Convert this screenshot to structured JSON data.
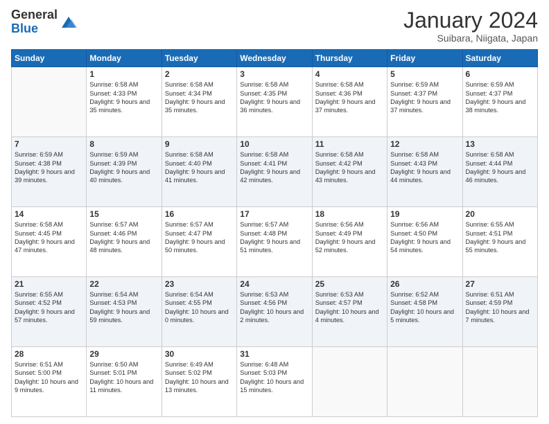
{
  "logo": {
    "general": "General",
    "blue": "Blue"
  },
  "header": {
    "title": "January 2024",
    "location": "Suibara, Niigata, Japan"
  },
  "weekdays": [
    "Sunday",
    "Monday",
    "Tuesday",
    "Wednesday",
    "Thursday",
    "Friday",
    "Saturday"
  ],
  "weeks": [
    [
      {
        "day": "",
        "sunrise": "",
        "sunset": "",
        "daylight": ""
      },
      {
        "day": "1",
        "sunrise": "Sunrise: 6:58 AM",
        "sunset": "Sunset: 4:33 PM",
        "daylight": "Daylight: 9 hours and 35 minutes."
      },
      {
        "day": "2",
        "sunrise": "Sunrise: 6:58 AM",
        "sunset": "Sunset: 4:34 PM",
        "daylight": "Daylight: 9 hours and 35 minutes."
      },
      {
        "day": "3",
        "sunrise": "Sunrise: 6:58 AM",
        "sunset": "Sunset: 4:35 PM",
        "daylight": "Daylight: 9 hours and 36 minutes."
      },
      {
        "day": "4",
        "sunrise": "Sunrise: 6:58 AM",
        "sunset": "Sunset: 4:36 PM",
        "daylight": "Daylight: 9 hours and 37 minutes."
      },
      {
        "day": "5",
        "sunrise": "Sunrise: 6:59 AM",
        "sunset": "Sunset: 4:37 PM",
        "daylight": "Daylight: 9 hours and 37 minutes."
      },
      {
        "day": "6",
        "sunrise": "Sunrise: 6:59 AM",
        "sunset": "Sunset: 4:37 PM",
        "daylight": "Daylight: 9 hours and 38 minutes."
      }
    ],
    [
      {
        "day": "7",
        "sunrise": "Sunrise: 6:59 AM",
        "sunset": "Sunset: 4:38 PM",
        "daylight": "Daylight: 9 hours and 39 minutes."
      },
      {
        "day": "8",
        "sunrise": "Sunrise: 6:59 AM",
        "sunset": "Sunset: 4:39 PM",
        "daylight": "Daylight: 9 hours and 40 minutes."
      },
      {
        "day": "9",
        "sunrise": "Sunrise: 6:58 AM",
        "sunset": "Sunset: 4:40 PM",
        "daylight": "Daylight: 9 hours and 41 minutes."
      },
      {
        "day": "10",
        "sunrise": "Sunrise: 6:58 AM",
        "sunset": "Sunset: 4:41 PM",
        "daylight": "Daylight: 9 hours and 42 minutes."
      },
      {
        "day": "11",
        "sunrise": "Sunrise: 6:58 AM",
        "sunset": "Sunset: 4:42 PM",
        "daylight": "Daylight: 9 hours and 43 minutes."
      },
      {
        "day": "12",
        "sunrise": "Sunrise: 6:58 AM",
        "sunset": "Sunset: 4:43 PM",
        "daylight": "Daylight: 9 hours and 44 minutes."
      },
      {
        "day": "13",
        "sunrise": "Sunrise: 6:58 AM",
        "sunset": "Sunset: 4:44 PM",
        "daylight": "Daylight: 9 hours and 46 minutes."
      }
    ],
    [
      {
        "day": "14",
        "sunrise": "Sunrise: 6:58 AM",
        "sunset": "Sunset: 4:45 PM",
        "daylight": "Daylight: 9 hours and 47 minutes."
      },
      {
        "day": "15",
        "sunrise": "Sunrise: 6:57 AM",
        "sunset": "Sunset: 4:46 PM",
        "daylight": "Daylight: 9 hours and 48 minutes."
      },
      {
        "day": "16",
        "sunrise": "Sunrise: 6:57 AM",
        "sunset": "Sunset: 4:47 PM",
        "daylight": "Daylight: 9 hours and 50 minutes."
      },
      {
        "day": "17",
        "sunrise": "Sunrise: 6:57 AM",
        "sunset": "Sunset: 4:48 PM",
        "daylight": "Daylight: 9 hours and 51 minutes."
      },
      {
        "day": "18",
        "sunrise": "Sunrise: 6:56 AM",
        "sunset": "Sunset: 4:49 PM",
        "daylight": "Daylight: 9 hours and 52 minutes."
      },
      {
        "day": "19",
        "sunrise": "Sunrise: 6:56 AM",
        "sunset": "Sunset: 4:50 PM",
        "daylight": "Daylight: 9 hours and 54 minutes."
      },
      {
        "day": "20",
        "sunrise": "Sunrise: 6:55 AM",
        "sunset": "Sunset: 4:51 PM",
        "daylight": "Daylight: 9 hours and 55 minutes."
      }
    ],
    [
      {
        "day": "21",
        "sunrise": "Sunrise: 6:55 AM",
        "sunset": "Sunset: 4:52 PM",
        "daylight": "Daylight: 9 hours and 57 minutes."
      },
      {
        "day": "22",
        "sunrise": "Sunrise: 6:54 AM",
        "sunset": "Sunset: 4:53 PM",
        "daylight": "Daylight: 9 hours and 59 minutes."
      },
      {
        "day": "23",
        "sunrise": "Sunrise: 6:54 AM",
        "sunset": "Sunset: 4:55 PM",
        "daylight": "Daylight: 10 hours and 0 minutes."
      },
      {
        "day": "24",
        "sunrise": "Sunrise: 6:53 AM",
        "sunset": "Sunset: 4:56 PM",
        "daylight": "Daylight: 10 hours and 2 minutes."
      },
      {
        "day": "25",
        "sunrise": "Sunrise: 6:53 AM",
        "sunset": "Sunset: 4:57 PM",
        "daylight": "Daylight: 10 hours and 4 minutes."
      },
      {
        "day": "26",
        "sunrise": "Sunrise: 6:52 AM",
        "sunset": "Sunset: 4:58 PM",
        "daylight": "Daylight: 10 hours and 5 minutes."
      },
      {
        "day": "27",
        "sunrise": "Sunrise: 6:51 AM",
        "sunset": "Sunset: 4:59 PM",
        "daylight": "Daylight: 10 hours and 7 minutes."
      }
    ],
    [
      {
        "day": "28",
        "sunrise": "Sunrise: 6:51 AM",
        "sunset": "Sunset: 5:00 PM",
        "daylight": "Daylight: 10 hours and 9 minutes."
      },
      {
        "day": "29",
        "sunrise": "Sunrise: 6:50 AM",
        "sunset": "Sunset: 5:01 PM",
        "daylight": "Daylight: 10 hours and 11 minutes."
      },
      {
        "day": "30",
        "sunrise": "Sunrise: 6:49 AM",
        "sunset": "Sunset: 5:02 PM",
        "daylight": "Daylight: 10 hours and 13 minutes."
      },
      {
        "day": "31",
        "sunrise": "Sunrise: 6:48 AM",
        "sunset": "Sunset: 5:03 PM",
        "daylight": "Daylight: 10 hours and 15 minutes."
      },
      {
        "day": "",
        "sunrise": "",
        "sunset": "",
        "daylight": ""
      },
      {
        "day": "",
        "sunrise": "",
        "sunset": "",
        "daylight": ""
      },
      {
        "day": "",
        "sunrise": "",
        "sunset": "",
        "daylight": ""
      }
    ]
  ]
}
